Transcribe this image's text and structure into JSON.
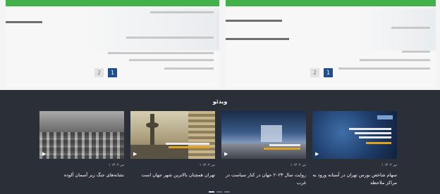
{
  "colors": {
    "accent": "#43b14a",
    "brand": "#1d4f91",
    "dark_bg": "#2b3038"
  },
  "articles": {
    "left": {
      "pagination": {
        "current": "1",
        "next": "2"
      }
    },
    "right": {
      "pagination": {
        "current": "1",
        "next": "2"
      }
    }
  },
  "videos": {
    "section_title": "ویدئو",
    "items": [
      {
        "date": "۱ تیر ۱۴۰۲",
        "title": "نشانه‌های جنگ زیر آسمان آلوده",
        "thumb_icon": "cars-photo"
      },
      {
        "date": "۱ تیر ۱۴۰۲",
        "title": "تهران همچنان بالاترین شهر جهان است",
        "thumb_icon": "tower-smog-photo"
      },
      {
        "date": "۱ تیر ۱۴۰۲",
        "title": "روایت سال ۲۰۲۳ جهان در کنار سیاست در غرب",
        "thumb_icon": "clouds-photo"
      },
      {
        "date": "۱ تیر ۱۴۰۲",
        "title": "سهام شاخص بورس تهران در آستانه ورود به مراکز ملاحظه",
        "thumb_icon": "news-graphic"
      }
    ]
  }
}
